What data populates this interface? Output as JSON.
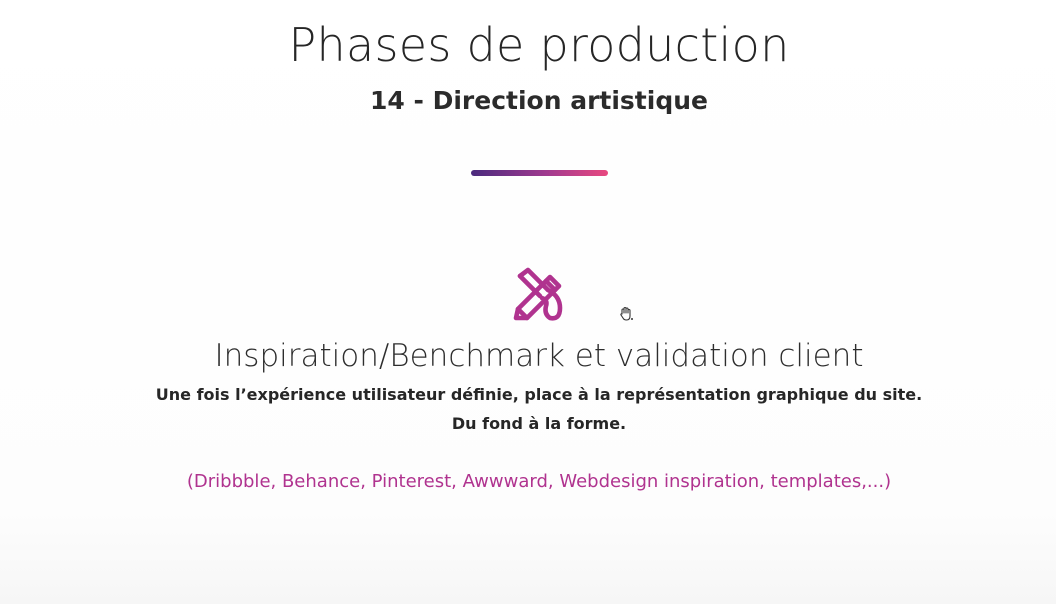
{
  "slide": {
    "title": "Phases de production",
    "subtitle": "14 - Direction artistique",
    "section_title": "Inspiration/Benchmark et validation client",
    "description_line1": "Une fois l’expérience utilisateur définie, place à la représentation graphique du site.",
    "description_line2": "Du fond à la forme.",
    "examples": "(Dribbble, Behance, Pinterest, Awwward, Webdesign inspiration, templates,...)"
  },
  "icons": {
    "main": "pencil-brush-icon",
    "cursor": "hand-cursor-icon"
  },
  "colors": {
    "accent": "#b0338f",
    "gradient_start": "#4a2a7d",
    "gradient_end": "#e8487f",
    "text": "#262626"
  }
}
